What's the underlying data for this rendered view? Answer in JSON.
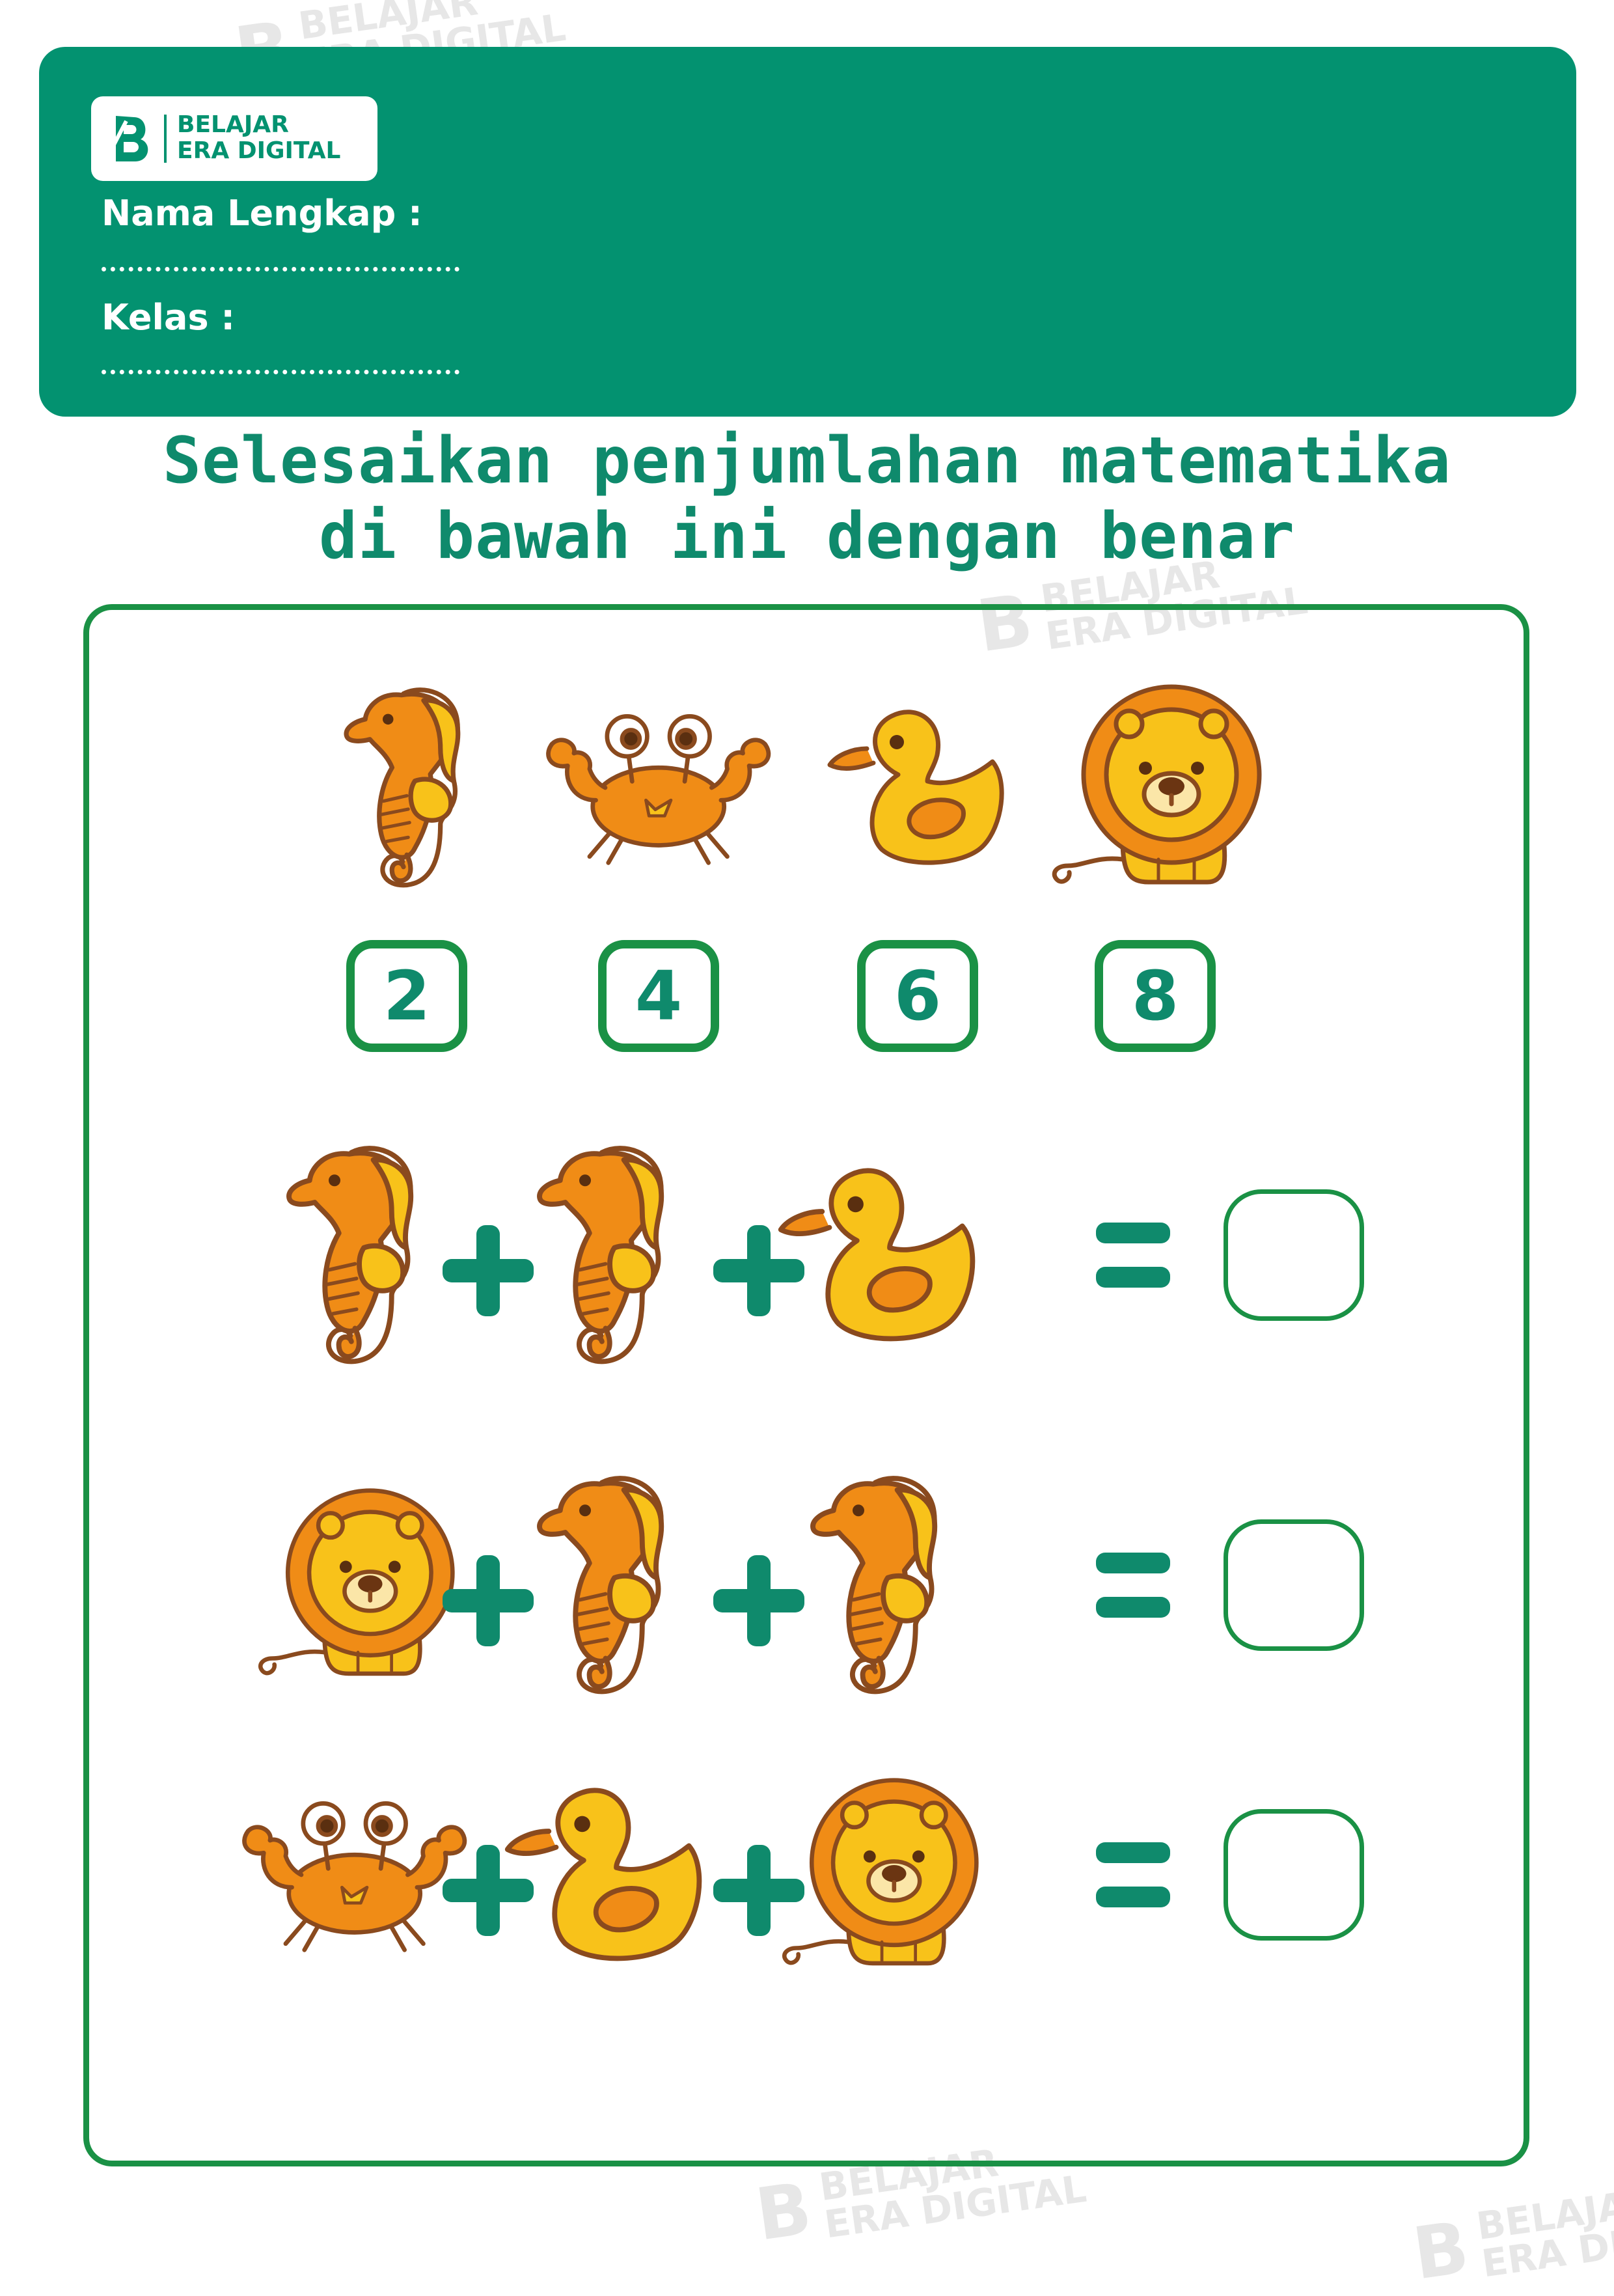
{
  "brand": {
    "line1": "BELAJAR",
    "line2": "ERA DIGITAL",
    "mark": "B"
  },
  "form": {
    "name_label": "Nama Lengkap :",
    "class_label": "Kelas :"
  },
  "title": {
    "line1": "Selesaikan penjumlahan matematika",
    "line2": "di bawah ini dengan benar"
  },
  "key": [
    {
      "animal": "seahorse-icon",
      "value": "2"
    },
    {
      "animal": "crab-icon",
      "value": "4"
    },
    {
      "animal": "duck-icon",
      "value": "6"
    },
    {
      "animal": "lion-icon",
      "value": "8"
    }
  ],
  "problems": [
    {
      "terms": [
        "seahorse-icon",
        "seahorse-icon",
        "duck-icon"
      ],
      "answer": ""
    },
    {
      "terms": [
        "lion-icon",
        "seahorse-icon",
        "seahorse-icon"
      ],
      "answer": ""
    },
    {
      "terms": [
        "crab-icon",
        "duck-icon",
        "lion-icon"
      ],
      "answer": ""
    }
  ],
  "colors": {
    "header_green": "#039270",
    "title_green": "#0f8a6c",
    "border_green": "#1a9145",
    "animal_orange": "#f08c16",
    "animal_yellow": "#f8c21a",
    "outline_brown": "#8a4a1e"
  }
}
